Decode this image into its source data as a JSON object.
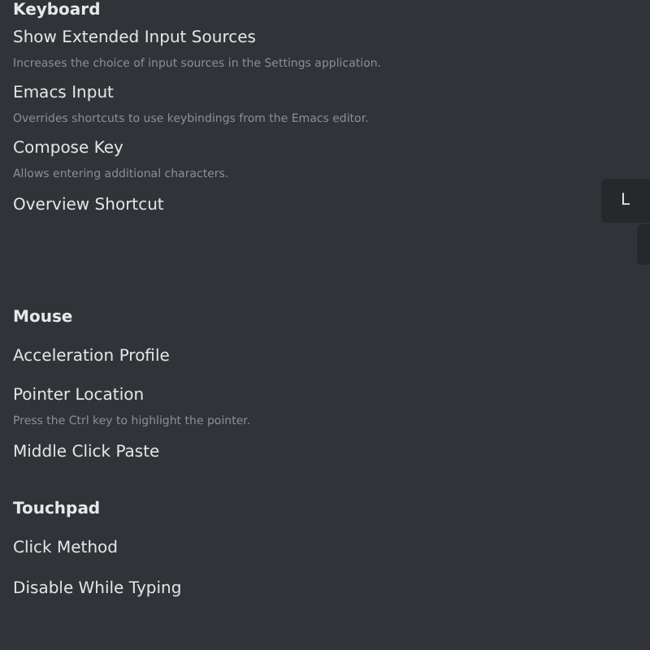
{
  "sections": [
    {
      "title": "Keyboard",
      "items": [
        {
          "label": "Show Extended Input Sources",
          "description": "Increases the choice of input sources in the Settings application."
        },
        {
          "label": "Emacs Input",
          "description": "Overrides shortcuts to use keybindings from the Emacs editor."
        },
        {
          "label": "Compose Key",
          "description": "Allows entering additional characters."
        },
        {
          "label": "Overview Shortcut",
          "control": "L"
        }
      ]
    },
    {
      "title": "Mouse",
      "items": [
        {
          "label": "Acceleration Profile"
        },
        {
          "label": "Pointer Location",
          "description": "Press the Ctrl key to highlight the pointer."
        },
        {
          "label": "Middle Click Paste"
        }
      ]
    },
    {
      "title": "Touchpad",
      "items": [
        {
          "label": "Click Method"
        },
        {
          "label": "Disable While Typing"
        }
      ]
    }
  ]
}
